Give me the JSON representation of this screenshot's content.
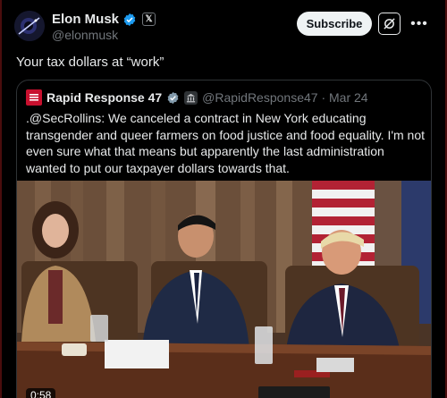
{
  "author": {
    "name": "Elon Musk",
    "handle": "@elonmusk",
    "x_badge": "𝕏"
  },
  "actions": {
    "subscribe_label": "Subscribe",
    "more_label": "•••"
  },
  "tweet": {
    "text": "Your tax dollars at “work”"
  },
  "quoted": {
    "name": "Rapid Response 47",
    "handle_time": "@RapidResponse47 · Mar 24",
    "text": ".@SecRollins: We canceled a contract in New York educating transgender and queer farmers on food justice and food equality. I'm not even sure what that means but apparently the last administration wanted to put our taxpayer dollars towards that.",
    "video_duration": "0:58"
  },
  "colors": {
    "background": "#000000",
    "text": "#e7e9ea",
    "secondary": "#71767b",
    "verified": "#1d9bf0",
    "border": "#2f3336"
  }
}
